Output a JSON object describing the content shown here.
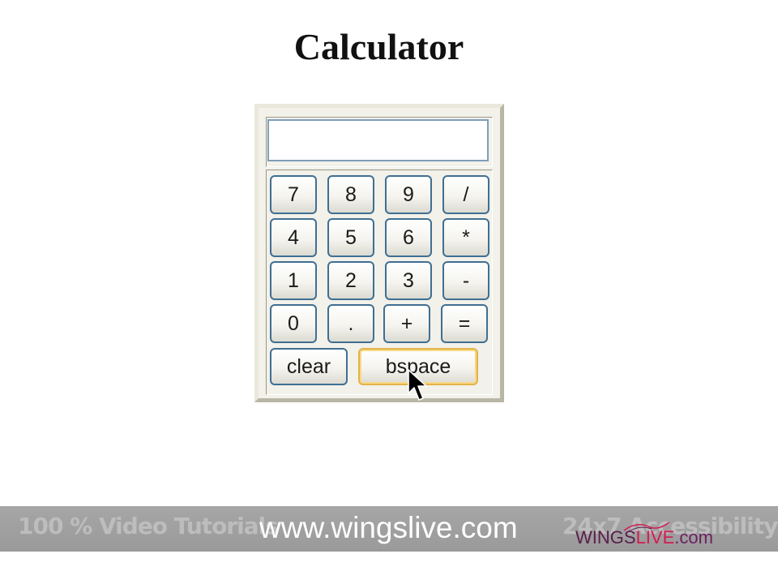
{
  "page": {
    "title": "Calculator"
  },
  "calculator": {
    "display_value": "",
    "keys": [
      [
        "7",
        "8",
        "9",
        "/"
      ],
      [
        "4",
        "5",
        "6",
        "*"
      ],
      [
        "1",
        "2",
        "3",
        "-"
      ],
      [
        "0",
        ".",
        "+",
        "="
      ]
    ],
    "clear_label": "clear",
    "bspace_label": "bspace"
  },
  "footer": {
    "left_text": "100 % Video Tutorials",
    "url_text": "www.wingslive.com",
    "right_text": "24x7 Accessibility",
    "logo": {
      "wings": "WINGS",
      "live": "LIVE",
      "com": ".com"
    }
  },
  "colors": {
    "key_border": "#3f6f93",
    "focused_key_border": "#e3b24a",
    "logo_dark": "#5a1f4d",
    "logo_red": "#d31b52"
  },
  "icons": {
    "pointer": "arrow-cursor-icon"
  }
}
